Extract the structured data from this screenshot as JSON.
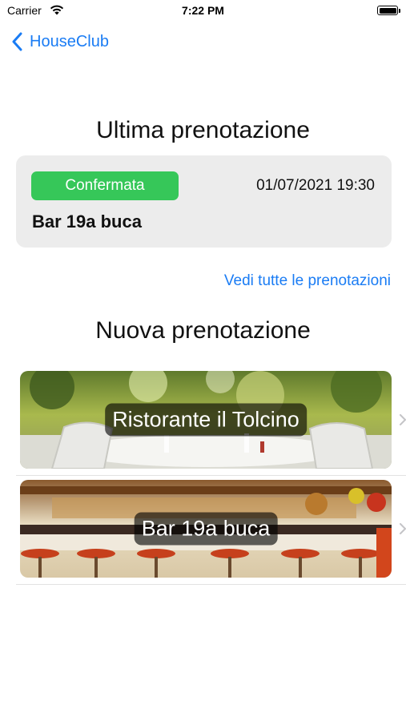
{
  "status_bar": {
    "carrier": "Carrier",
    "time": "7:22 PM"
  },
  "nav": {
    "back_label": "HouseClub"
  },
  "last_booking": {
    "title": "Ultima prenotazione",
    "status": "Confermata",
    "datetime": "01/07/2021 19:30",
    "venue": "Bar 19a buca",
    "status_color": "#36C759"
  },
  "see_all_link": "Vedi tutte le prenotazioni",
  "new_booking": {
    "title": "Nuova prenotazione",
    "venues": [
      {
        "name": "Ristorante il Tolcino"
      },
      {
        "name": "Bar 19a buca"
      }
    ]
  },
  "colors": {
    "accent": "#1A7CF4",
    "card_bg": "#ECECEC"
  }
}
